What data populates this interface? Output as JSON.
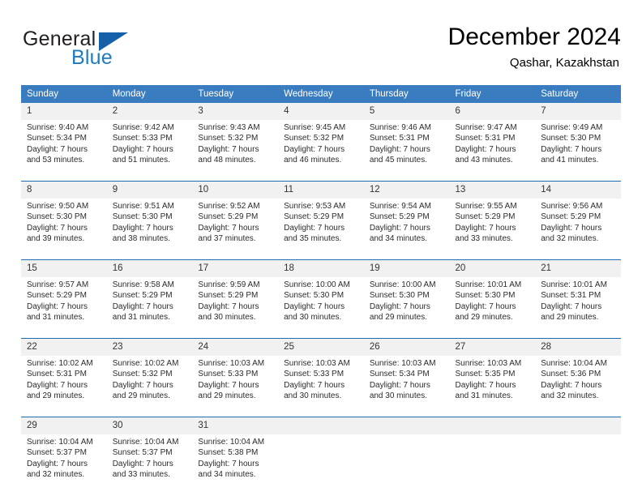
{
  "brand": {
    "name_top": "General",
    "name_bottom": "Blue",
    "triangle_color": "#1560a8",
    "blue_color": "#1f7bc1"
  },
  "header": {
    "title": "December 2024",
    "location": "Qashar, Kazakhstan"
  },
  "theme": {
    "header_bg": "#3a7cc0",
    "daynum_bg": "#f1f1f1",
    "rule_color": "#1f6cb0",
    "text_color": "#2b2b2b"
  },
  "calendar": {
    "weekday_headers": [
      "Sunday",
      "Monday",
      "Tuesday",
      "Wednesday",
      "Thursday",
      "Friday",
      "Saturday"
    ],
    "weeks": [
      {
        "days": [
          {
            "num": "1",
            "sunrise": "Sunrise: 9:40 AM",
            "sunset": "Sunset: 5:34 PM",
            "daylight_1": "Daylight: 7 hours",
            "daylight_2": "and 53 minutes."
          },
          {
            "num": "2",
            "sunrise": "Sunrise: 9:42 AM",
            "sunset": "Sunset: 5:33 PM",
            "daylight_1": "Daylight: 7 hours",
            "daylight_2": "and 51 minutes."
          },
          {
            "num": "3",
            "sunrise": "Sunrise: 9:43 AM",
            "sunset": "Sunset: 5:32 PM",
            "daylight_1": "Daylight: 7 hours",
            "daylight_2": "and 48 minutes."
          },
          {
            "num": "4",
            "sunrise": "Sunrise: 9:45 AM",
            "sunset": "Sunset: 5:32 PM",
            "daylight_1": "Daylight: 7 hours",
            "daylight_2": "and 46 minutes."
          },
          {
            "num": "5",
            "sunrise": "Sunrise: 9:46 AM",
            "sunset": "Sunset: 5:31 PM",
            "daylight_1": "Daylight: 7 hours",
            "daylight_2": "and 45 minutes."
          },
          {
            "num": "6",
            "sunrise": "Sunrise: 9:47 AM",
            "sunset": "Sunset: 5:31 PM",
            "daylight_1": "Daylight: 7 hours",
            "daylight_2": "and 43 minutes."
          },
          {
            "num": "7",
            "sunrise": "Sunrise: 9:49 AM",
            "sunset": "Sunset: 5:30 PM",
            "daylight_1": "Daylight: 7 hours",
            "daylight_2": "and 41 minutes."
          }
        ]
      },
      {
        "days": [
          {
            "num": "8",
            "sunrise": "Sunrise: 9:50 AM",
            "sunset": "Sunset: 5:30 PM",
            "daylight_1": "Daylight: 7 hours",
            "daylight_2": "and 39 minutes."
          },
          {
            "num": "9",
            "sunrise": "Sunrise: 9:51 AM",
            "sunset": "Sunset: 5:30 PM",
            "daylight_1": "Daylight: 7 hours",
            "daylight_2": "and 38 minutes."
          },
          {
            "num": "10",
            "sunrise": "Sunrise: 9:52 AM",
            "sunset": "Sunset: 5:29 PM",
            "daylight_1": "Daylight: 7 hours",
            "daylight_2": "and 37 minutes."
          },
          {
            "num": "11",
            "sunrise": "Sunrise: 9:53 AM",
            "sunset": "Sunset: 5:29 PM",
            "daylight_1": "Daylight: 7 hours",
            "daylight_2": "and 35 minutes."
          },
          {
            "num": "12",
            "sunrise": "Sunrise: 9:54 AM",
            "sunset": "Sunset: 5:29 PM",
            "daylight_1": "Daylight: 7 hours",
            "daylight_2": "and 34 minutes."
          },
          {
            "num": "13",
            "sunrise": "Sunrise: 9:55 AM",
            "sunset": "Sunset: 5:29 PM",
            "daylight_1": "Daylight: 7 hours",
            "daylight_2": "and 33 minutes."
          },
          {
            "num": "14",
            "sunrise": "Sunrise: 9:56 AM",
            "sunset": "Sunset: 5:29 PM",
            "daylight_1": "Daylight: 7 hours",
            "daylight_2": "and 32 minutes."
          }
        ]
      },
      {
        "days": [
          {
            "num": "15",
            "sunrise": "Sunrise: 9:57 AM",
            "sunset": "Sunset: 5:29 PM",
            "daylight_1": "Daylight: 7 hours",
            "daylight_2": "and 31 minutes."
          },
          {
            "num": "16",
            "sunrise": "Sunrise: 9:58 AM",
            "sunset": "Sunset: 5:29 PM",
            "daylight_1": "Daylight: 7 hours",
            "daylight_2": "and 31 minutes."
          },
          {
            "num": "17",
            "sunrise": "Sunrise: 9:59 AM",
            "sunset": "Sunset: 5:29 PM",
            "daylight_1": "Daylight: 7 hours",
            "daylight_2": "and 30 minutes."
          },
          {
            "num": "18",
            "sunrise": "Sunrise: 10:00 AM",
            "sunset": "Sunset: 5:30 PM",
            "daylight_1": "Daylight: 7 hours",
            "daylight_2": "and 30 minutes."
          },
          {
            "num": "19",
            "sunrise": "Sunrise: 10:00 AM",
            "sunset": "Sunset: 5:30 PM",
            "daylight_1": "Daylight: 7 hours",
            "daylight_2": "and 29 minutes."
          },
          {
            "num": "20",
            "sunrise": "Sunrise: 10:01 AM",
            "sunset": "Sunset: 5:30 PM",
            "daylight_1": "Daylight: 7 hours",
            "daylight_2": "and 29 minutes."
          },
          {
            "num": "21",
            "sunrise": "Sunrise: 10:01 AM",
            "sunset": "Sunset: 5:31 PM",
            "daylight_1": "Daylight: 7 hours",
            "daylight_2": "and 29 minutes."
          }
        ]
      },
      {
        "days": [
          {
            "num": "22",
            "sunrise": "Sunrise: 10:02 AM",
            "sunset": "Sunset: 5:31 PM",
            "daylight_1": "Daylight: 7 hours",
            "daylight_2": "and 29 minutes."
          },
          {
            "num": "23",
            "sunrise": "Sunrise: 10:02 AM",
            "sunset": "Sunset: 5:32 PM",
            "daylight_1": "Daylight: 7 hours",
            "daylight_2": "and 29 minutes."
          },
          {
            "num": "24",
            "sunrise": "Sunrise: 10:03 AM",
            "sunset": "Sunset: 5:33 PM",
            "daylight_1": "Daylight: 7 hours",
            "daylight_2": "and 29 minutes."
          },
          {
            "num": "25",
            "sunrise": "Sunrise: 10:03 AM",
            "sunset": "Sunset: 5:33 PM",
            "daylight_1": "Daylight: 7 hours",
            "daylight_2": "and 30 minutes."
          },
          {
            "num": "26",
            "sunrise": "Sunrise: 10:03 AM",
            "sunset": "Sunset: 5:34 PM",
            "daylight_1": "Daylight: 7 hours",
            "daylight_2": "and 30 minutes."
          },
          {
            "num": "27",
            "sunrise": "Sunrise: 10:03 AM",
            "sunset": "Sunset: 5:35 PM",
            "daylight_1": "Daylight: 7 hours",
            "daylight_2": "and 31 minutes."
          },
          {
            "num": "28",
            "sunrise": "Sunrise: 10:04 AM",
            "sunset": "Sunset: 5:36 PM",
            "daylight_1": "Daylight: 7 hours",
            "daylight_2": "and 32 minutes."
          }
        ]
      },
      {
        "days": [
          {
            "num": "29",
            "sunrise": "Sunrise: 10:04 AM",
            "sunset": "Sunset: 5:37 PM",
            "daylight_1": "Daylight: 7 hours",
            "daylight_2": "and 32 minutes."
          },
          {
            "num": "30",
            "sunrise": "Sunrise: 10:04 AM",
            "sunset": "Sunset: 5:37 PM",
            "daylight_1": "Daylight: 7 hours",
            "daylight_2": "and 33 minutes."
          },
          {
            "num": "31",
            "sunrise": "Sunrise: 10:04 AM",
            "sunset": "Sunset: 5:38 PM",
            "daylight_1": "Daylight: 7 hours",
            "daylight_2": "and 34 minutes."
          },
          {
            "num": "",
            "sunrise": "",
            "sunset": "",
            "daylight_1": "",
            "daylight_2": ""
          },
          {
            "num": "",
            "sunrise": "",
            "sunset": "",
            "daylight_1": "",
            "daylight_2": ""
          },
          {
            "num": "",
            "sunrise": "",
            "sunset": "",
            "daylight_1": "",
            "daylight_2": ""
          },
          {
            "num": "",
            "sunrise": "",
            "sunset": "",
            "daylight_1": "",
            "daylight_2": ""
          }
        ]
      }
    ]
  }
}
